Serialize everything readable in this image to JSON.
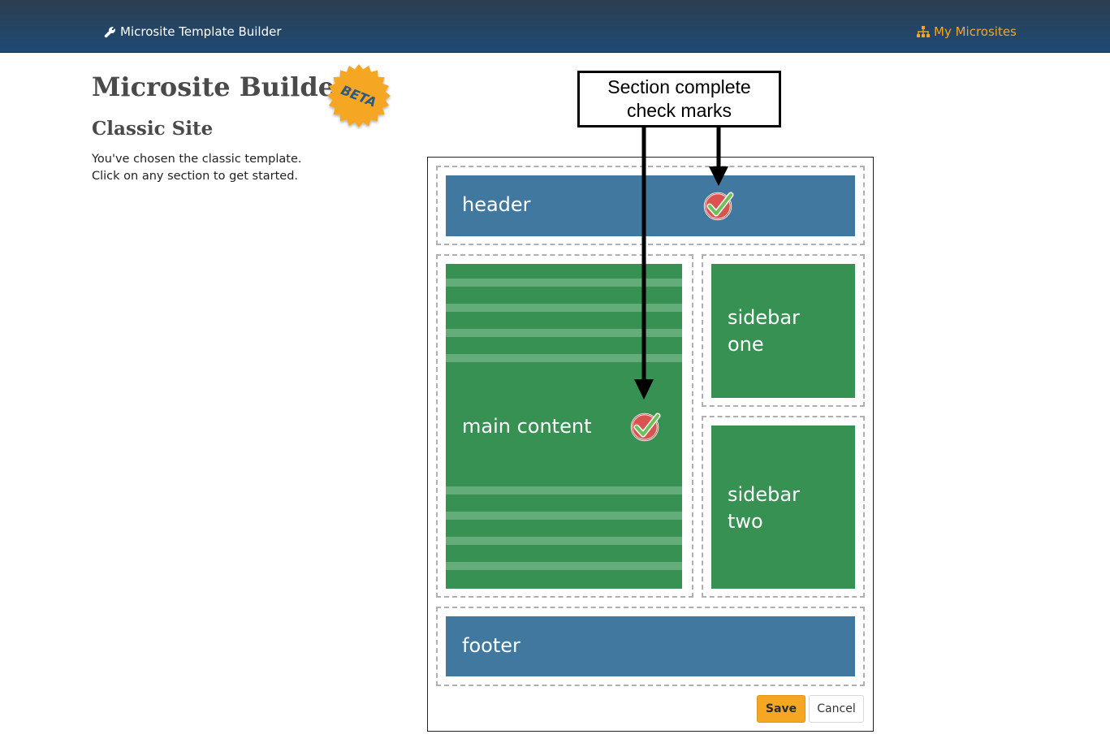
{
  "navbar": {
    "brand_label": "Microsite Template Builder",
    "brand_icon": "wrench-icon",
    "my_microsites_label": "My Microsites",
    "my_microsites_icon": "sitemap-icon",
    "brand_color": "#ffffff",
    "accent_color": "#f5a623"
  },
  "page": {
    "title": "Microsite Builder",
    "beta_badge": "BETA",
    "subtitle": "Classic Site",
    "intro_line1": "You've chosen the classic template.",
    "intro_line2": "Click on any section to get started."
  },
  "callout": {
    "line1": "Section complete",
    "line2": "check marks"
  },
  "template": {
    "sections": {
      "header": {
        "label": "header",
        "complete": true,
        "color": "#41789f"
      },
      "main_content": {
        "label": "main content",
        "complete": true,
        "color": "#379152"
      },
      "sidebar_one": {
        "line1": "sidebar",
        "line2": "one",
        "complete": false,
        "color": "#379152"
      },
      "sidebar_two": {
        "line1": "sidebar",
        "line2": "two",
        "complete": false,
        "color": "#379152"
      },
      "footer": {
        "label": "footer",
        "complete": false,
        "color": "#41789f"
      }
    }
  },
  "actions": {
    "save_label": "Save",
    "cancel_label": "Cancel"
  }
}
